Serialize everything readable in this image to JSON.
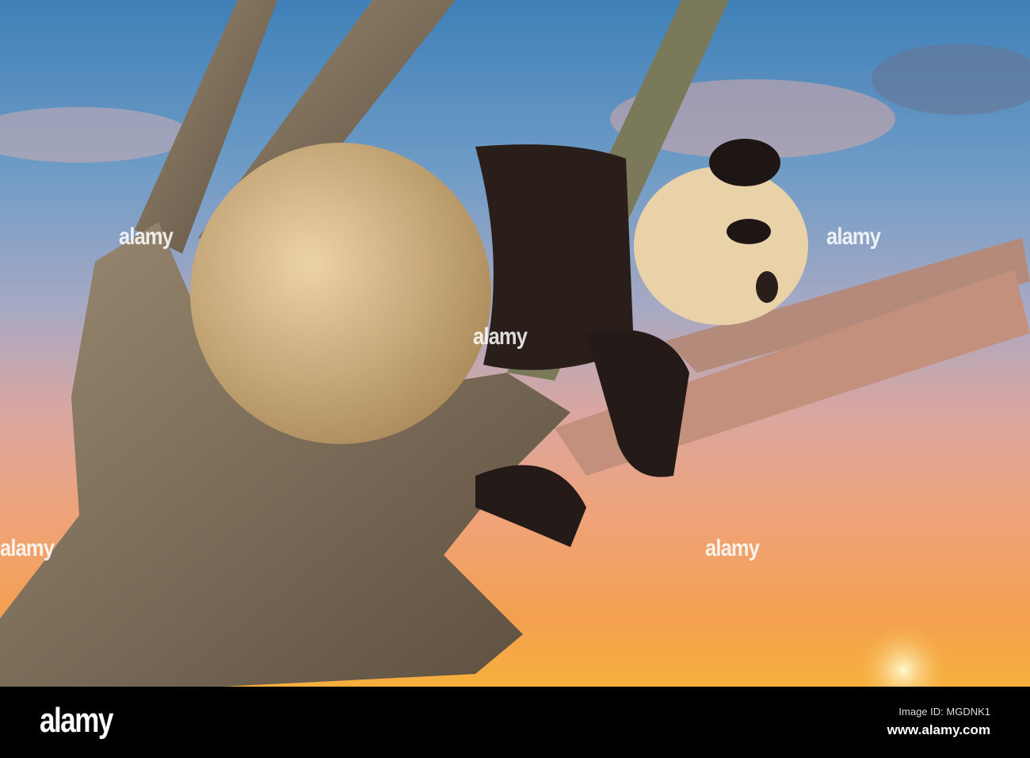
{
  "image": {
    "subject": "giant-panda-sleeping-in-tree",
    "colors": {
      "sky_top": "#3f80b8",
      "sky_bottom": "#f7b03c",
      "bark": "#8a7a66",
      "fur_light": "#e0c49a",
      "fur_dark": "#2a1e1a"
    }
  },
  "watermark": {
    "text": "alamy"
  },
  "footer": {
    "logo": "alamy",
    "image_id": "Image ID: MGDNK1",
    "url": "www.alamy.com"
  }
}
